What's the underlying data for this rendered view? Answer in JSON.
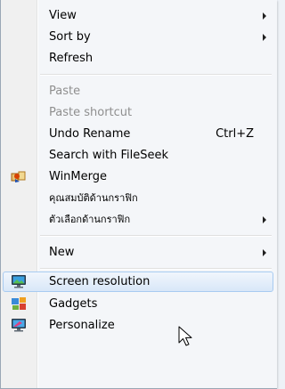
{
  "menu": {
    "items": [
      {
        "label": "View",
        "submenu": true
      },
      {
        "label": "Sort by",
        "submenu": true
      },
      {
        "label": "Refresh"
      },
      {
        "label": "Paste",
        "disabled": true
      },
      {
        "label": "Paste shortcut",
        "disabled": true
      },
      {
        "label": "Undo Rename",
        "shortcut": "Ctrl+Z"
      },
      {
        "label": "Search with FileSeek"
      },
      {
        "label": "WinMerge",
        "icon": "winmerge-icon"
      },
      {
        "label": "คุณสมบัติด้านกราฟิก"
      },
      {
        "label": "ตัวเลือกด้านกราฟิก",
        "submenu": true
      },
      {
        "label": "New",
        "submenu": true
      },
      {
        "label": "Screen resolution",
        "icon": "screen-resolution-icon",
        "highlighted": true
      },
      {
        "label": "Gadgets",
        "icon": "gadgets-icon"
      },
      {
        "label": "Personalize",
        "icon": "personalize-icon"
      }
    ]
  },
  "colors": {
    "menu_background": "#f4f6f9",
    "highlight_border": "#a8cbf1",
    "disabled_text": "#8f8f8f"
  }
}
